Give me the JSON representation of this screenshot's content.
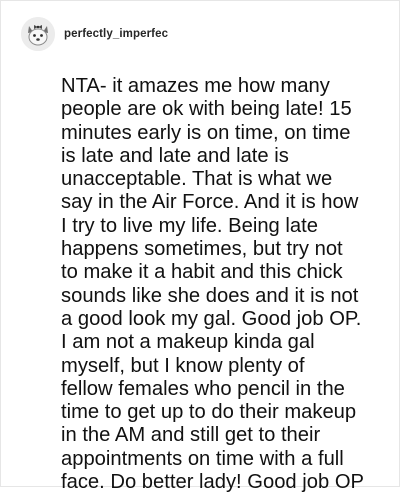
{
  "post": {
    "avatar_icon": "dog-avatar-icon",
    "username": "perfectly_imperfec",
    "comment_text": "NTA- it amazes me how many\npeople are ok with being late! 15\nminutes early is on time, on time\nis late and late and late is\nunacceptable. That is what we\nsay in the Air Force. And it is how\nI try to live my life. Being late\nhappens sometimes, but try not\nto make it a habit and this chick\nsounds like she does and it is not\na good look my gal. Good job OP.\nI am not a makeup kinda gal\nmyself, but I know plenty of\nfellow females who pencil in the\ntime to get up to do their makeup\nin the AM and still get to their\nappointments on time with a full\nface. Do better lady! Good job OP"
  },
  "colors": {
    "background": "#ffffff",
    "border": "#e6e6e6",
    "username": "#262626",
    "text": "#111111"
  }
}
